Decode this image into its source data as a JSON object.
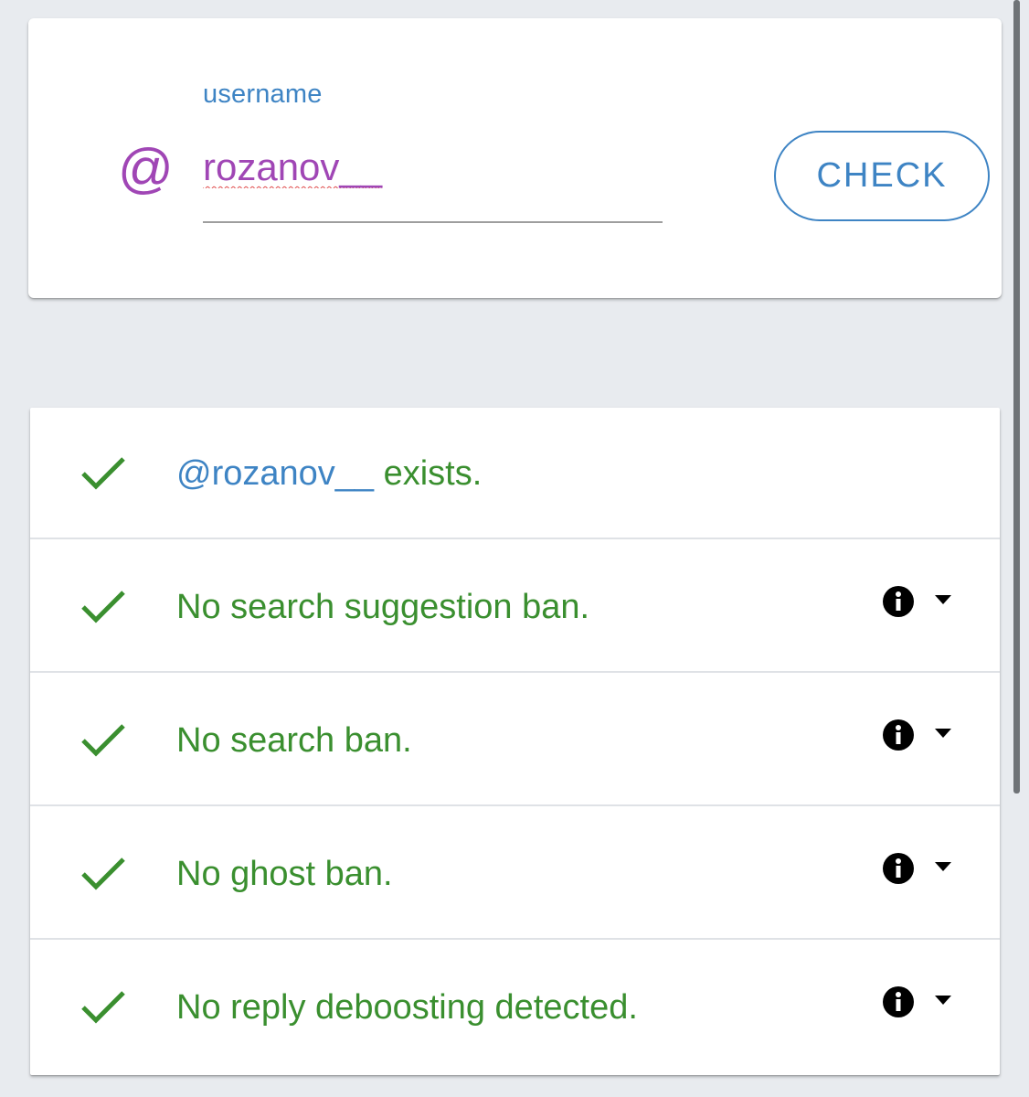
{
  "lookup": {
    "field_label": "username",
    "at_symbol": "@",
    "username_value": "rozanov__",
    "check_label": "CHECK"
  },
  "results": {
    "exists_handle": "@rozanov__",
    "exists_suffix": " exists.",
    "items": [
      {
        "label": "No search suggestion ban."
      },
      {
        "label": "No search ban."
      },
      {
        "label": "No ghost ban."
      },
      {
        "label": "No reply deboosting detected."
      }
    ]
  },
  "icons": {
    "prefix": "at-icon",
    "status": "check-icon",
    "info": "info-icon",
    "expand": "caret-down-icon"
  },
  "colors": {
    "accent_blue": "#3e84c4",
    "username_purple": "#a046b5",
    "success_green": "#3a8f2f",
    "background": "#e8ebef"
  }
}
